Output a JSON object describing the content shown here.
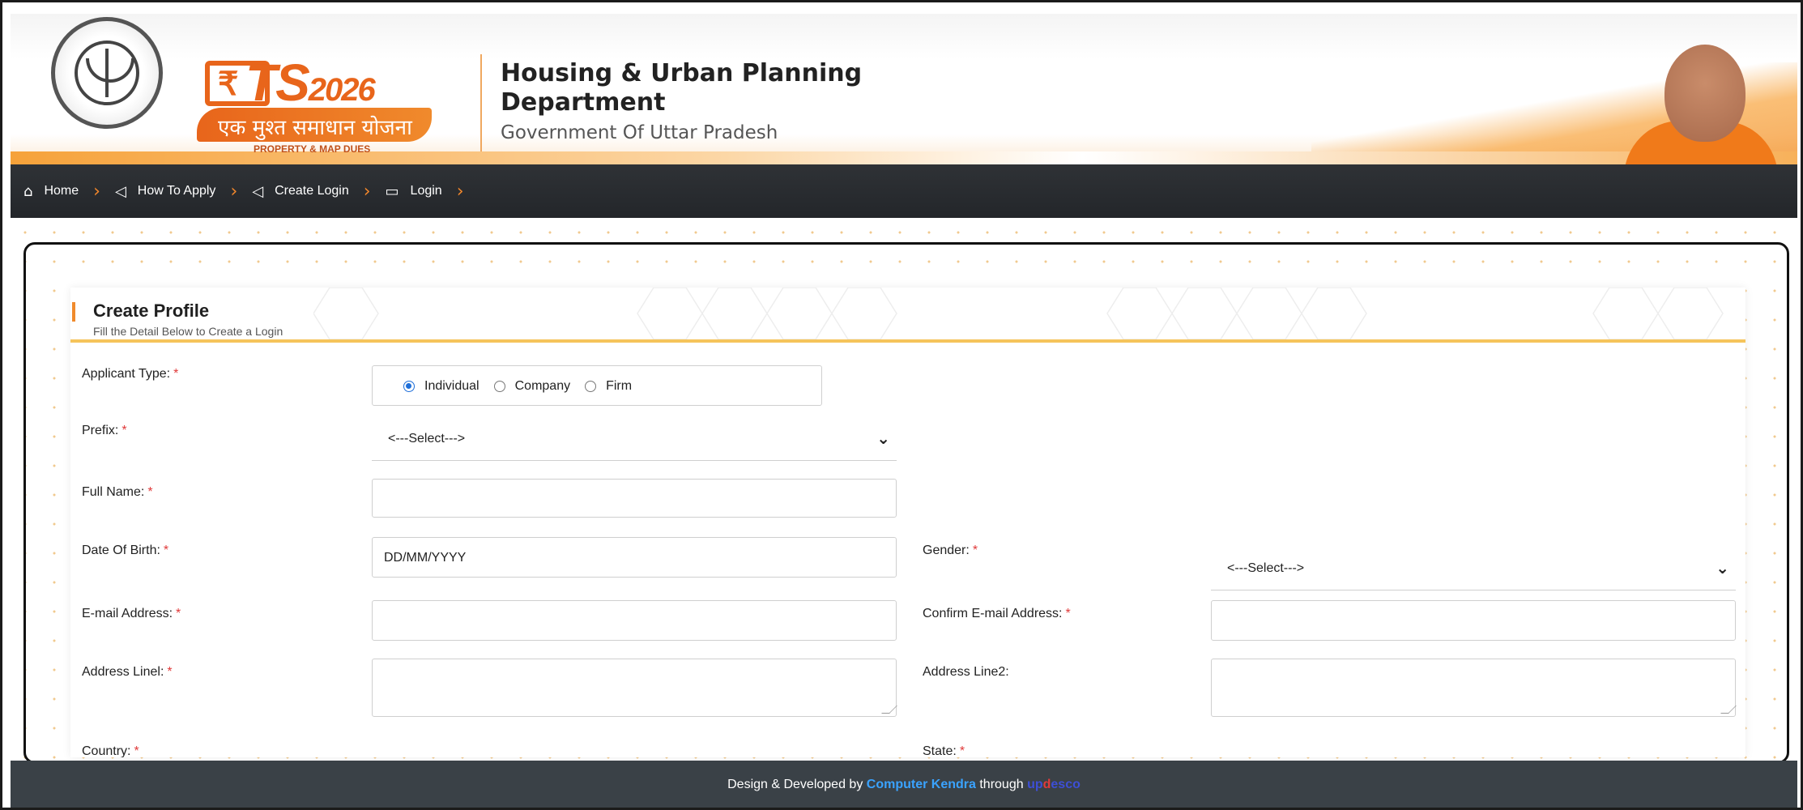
{
  "header": {
    "logo_ts": "TS",
    "logo_year": "2026",
    "logo_house": "₹",
    "logo_tagline": "एक मुश्त समाधान योजना",
    "logo_sub": "PROPERTY & MAP DUES",
    "title": "Housing & Urban Planning Department",
    "subtitle": "Government Of Uttar Pradesh"
  },
  "nav": {
    "items": [
      {
        "label": "Home",
        "icon": "home-icon"
      },
      {
        "label": "How To Apply",
        "icon": "megaphone-icon"
      },
      {
        "label": "Create Login",
        "icon": "megaphone-icon"
      },
      {
        "label": "Login",
        "icon": "id-card-icon"
      }
    ]
  },
  "form": {
    "title": "Create Profile",
    "subtitle": "Fill the Detail Below to Create a Login",
    "applicant_type_label": "Applicant Type:",
    "applicant_types": [
      "Individual",
      "Company",
      "Firm"
    ],
    "applicant_type_selected": "Individual",
    "prefix_label": "Prefix:",
    "prefix_value": "<---Select--->",
    "full_name_label": "Full Name:",
    "full_name_value": "",
    "dob_label": "Date Of Birth:",
    "dob_value": "DD/MM/YYYY",
    "gender_label": "Gender:",
    "gender_value": "<---Select--->",
    "email_label": "E-mail Address:",
    "email_value": "",
    "confirm_email_label": "Confirm E-mail Address:",
    "confirm_email_value": "",
    "address1_label": "Address Linel:",
    "address1_value": "",
    "address2_label": "Address Line2:",
    "address2_value": "",
    "country_label": "Country:",
    "state_label": "State:",
    "required_mark": "*"
  },
  "footer": {
    "prefix": "Design & Developed by",
    "brand": "Computer Kendra",
    "through": "through",
    "partner_a": "up",
    "partner_b": "d",
    "partner_c": "esco"
  },
  "colors": {
    "accent": "#f08a2c",
    "nav_bg": "#2f3236",
    "footer_bg": "#3a4147",
    "required": "#e03a3a",
    "radio_checked": "#1e6fd9"
  }
}
